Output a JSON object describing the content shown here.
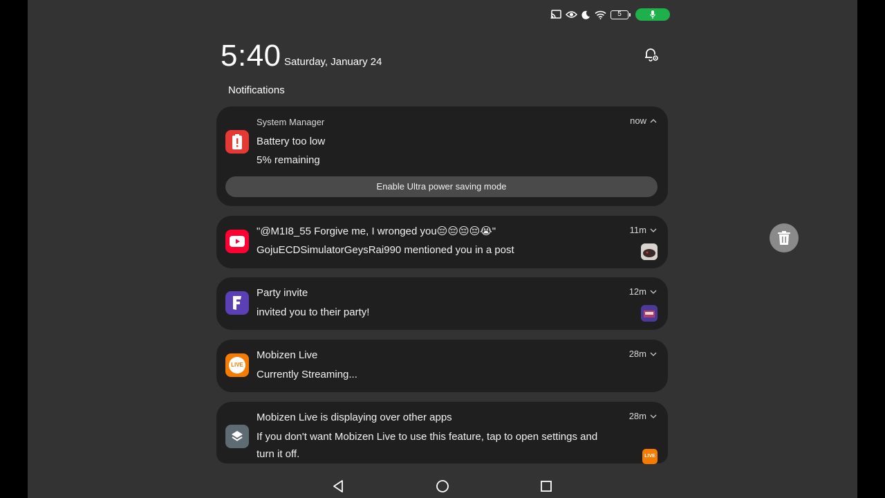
{
  "status_bar": {
    "icons": [
      "cast-icon",
      "eye-icon",
      "moon-icon",
      "wifi-icon",
      "battery-icon",
      "mic-icon"
    ],
    "battery_level": "5",
    "recording_color": "#1fb04b"
  },
  "header": {
    "time": "5:40",
    "date": "Saturday, January 24",
    "section_title": "Notifications"
  },
  "notifications": [
    {
      "app": "System Manager",
      "title": "Battery too low",
      "body": "5% remaining",
      "time": "now",
      "expanded": true,
      "action": "Enable Ultra power saving mode",
      "icon": "battery-alert-icon",
      "icon_color": "#e53935"
    },
    {
      "title": "\"@M1I8_55 Forgive me, I wronged you😔😔😔😔😭\"",
      "body": "GojuECDSimulatorGeysRai990 mentioned you in a post",
      "time": "11m",
      "icon": "youtube-icon",
      "icon_color": "#ff0033"
    },
    {
      "title": "Party invite",
      "body": "invited you to their party!",
      "time": "12m",
      "icon": "fortnite-icon",
      "icon_color": "#5b3fb5"
    },
    {
      "title": "Mobizen Live",
      "body": "Currently Streaming...",
      "time": "28m",
      "icon": "mobizen-live-icon",
      "icon_color": "#f57c00",
      "icon_text": "LIVE"
    },
    {
      "title": "Mobizen Live is displaying over other apps",
      "body_line1": "If you don't want Mobizen Live to use this feature, tap to open settings and",
      "body_line2": "turn it off.",
      "time": "28m",
      "icon": "layers-icon",
      "icon_color": "#5f6b73",
      "badge_text": "LIVE"
    }
  ],
  "clear_all": {
    "icon": "trash-icon"
  },
  "nav": {
    "icons": [
      "back-icon",
      "home-icon",
      "recents-icon"
    ]
  }
}
